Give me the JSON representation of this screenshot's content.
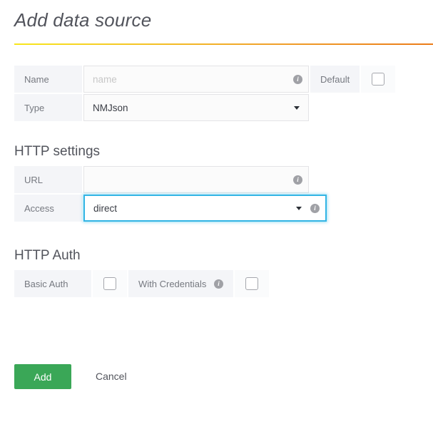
{
  "page": {
    "title": "Add data source"
  },
  "form": {
    "name_row": {
      "label": "Name",
      "input_value": "",
      "input_placeholder": "name",
      "info_icon": "info-icon",
      "default_label": "Default",
      "default_checked": false
    },
    "type_row": {
      "label": "Type",
      "selected": "NMJson",
      "caret_icon": "chevron-down-icon"
    }
  },
  "http_settings": {
    "heading": "HTTP settings",
    "url_row": {
      "label": "URL",
      "input_value": "",
      "input_placeholder": "",
      "info_icon": "info-icon"
    },
    "access_row": {
      "label": "Access",
      "selected": "direct",
      "caret_icon": "chevron-down-icon",
      "info_icon": "info-icon",
      "focused": true,
      "focus_color": "#33b5e5"
    }
  },
  "http_auth": {
    "heading": "HTTP Auth",
    "basic_auth": {
      "label": "Basic Auth",
      "checked": false
    },
    "with_credentials": {
      "label": "With Credentials",
      "info_icon": "info-icon",
      "checked": false
    }
  },
  "actions": {
    "add_label": "Add",
    "cancel_label": "Cancel",
    "add_color": "#3aa757"
  },
  "icons": {
    "info_glyph": "i"
  }
}
